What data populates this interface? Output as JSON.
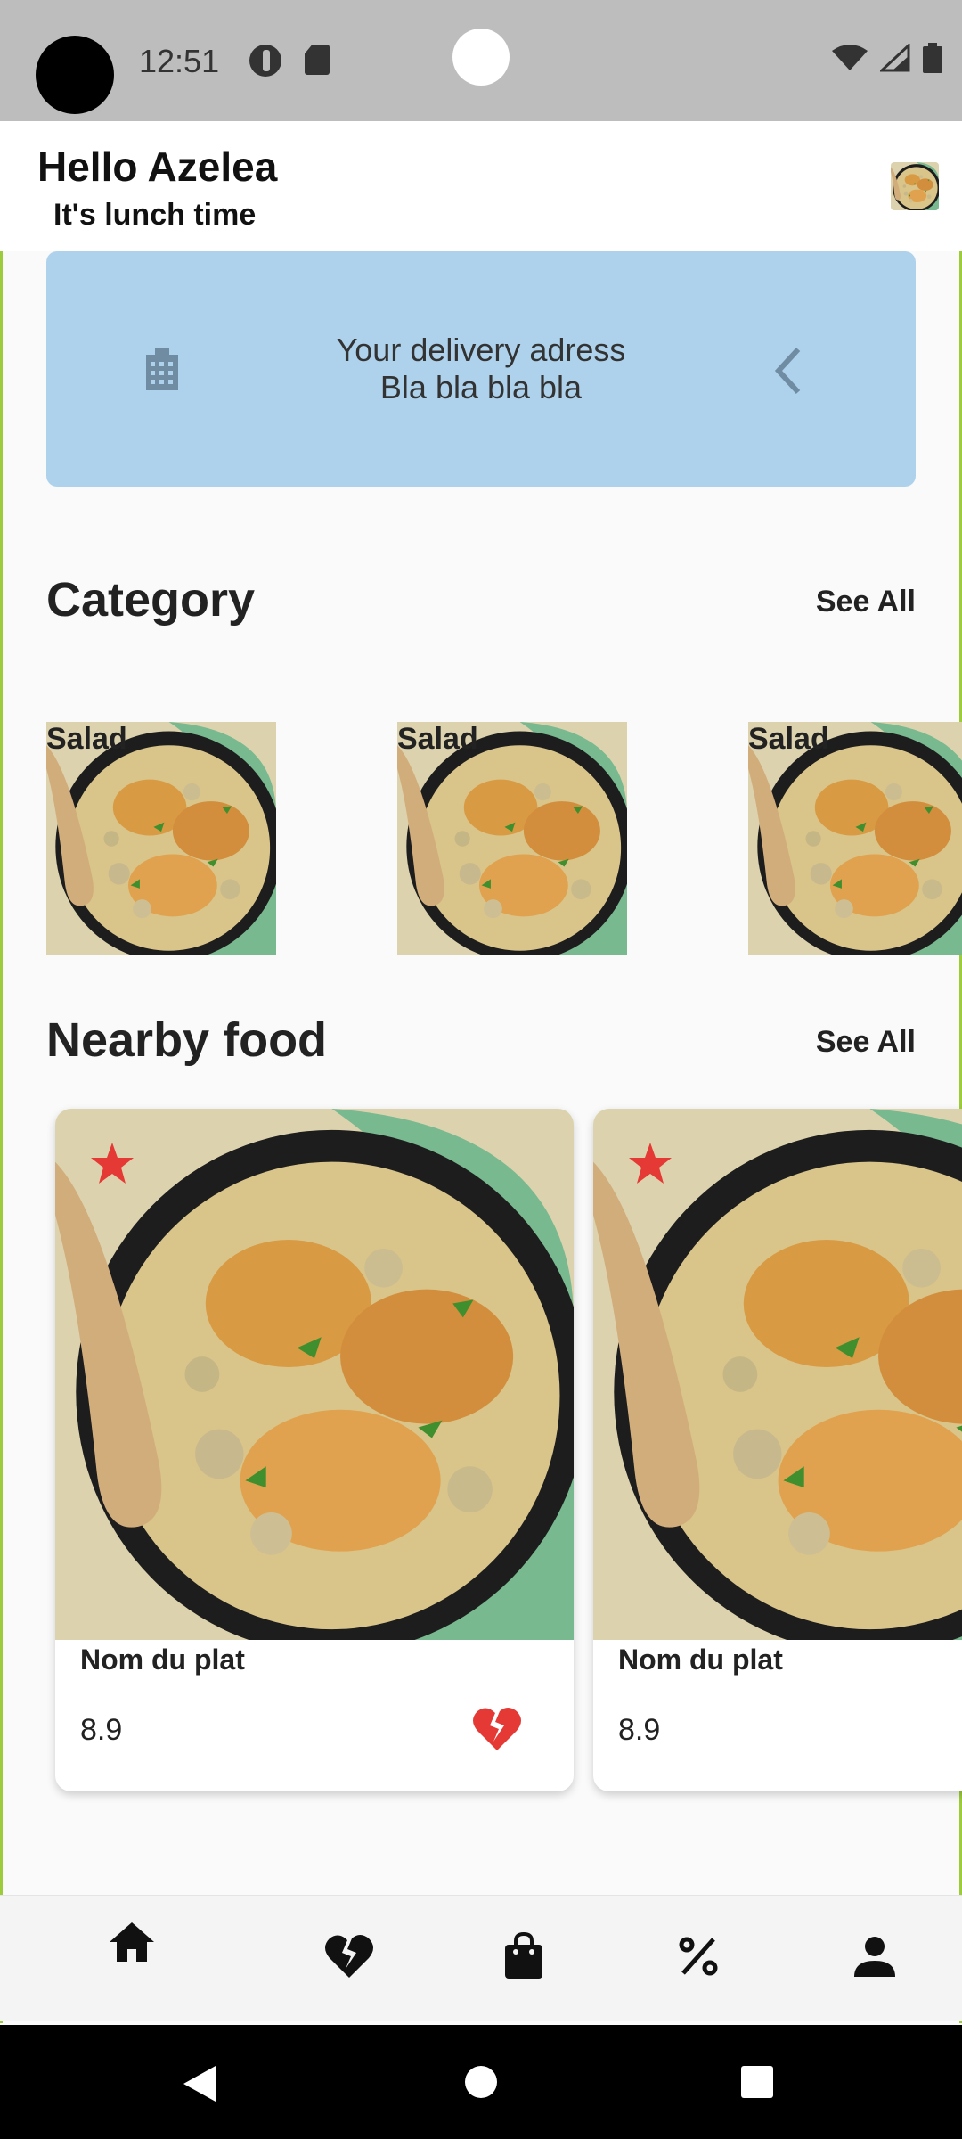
{
  "status_bar": {
    "time": "12:51"
  },
  "header": {
    "greeting": "Hello Azelea",
    "subtitle": "It's lunch time"
  },
  "delivery": {
    "line1": "Your delivery adress",
    "line2": "Bla bla bla bla"
  },
  "category": {
    "title": "Category",
    "see_all": "See All",
    "items": [
      {
        "label": "Salad"
      },
      {
        "label": "Salad"
      },
      {
        "label": "Salad"
      }
    ]
  },
  "nearby": {
    "title": "Nearby food",
    "see_all": "See All",
    "items": [
      {
        "name": "Nom du plat",
        "rating": "8.9"
      },
      {
        "name": "Nom du plat",
        "rating": "8.9"
      }
    ]
  },
  "bottom_nav": {
    "items": [
      "home-icon",
      "heart-broken-icon",
      "shopping-bag-icon",
      "percent-icon",
      "person-icon"
    ]
  },
  "colors": {
    "accent": "#aed2ec",
    "star": "#e53935",
    "frame": "#9ccc3c"
  }
}
